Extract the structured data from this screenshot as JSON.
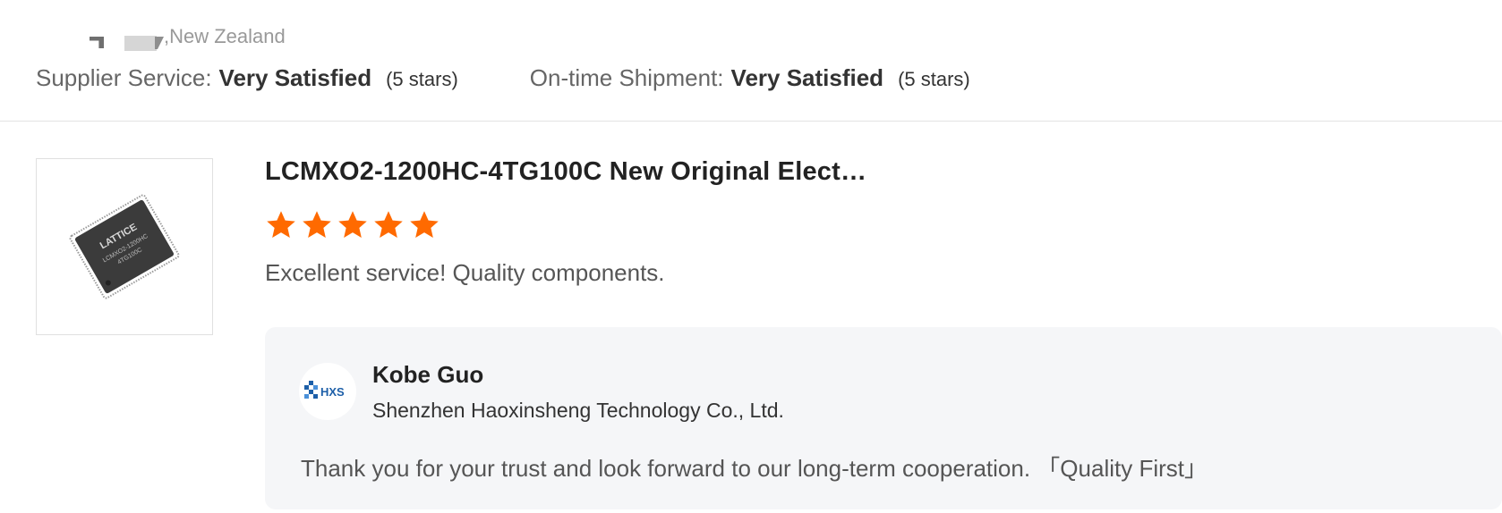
{
  "reviewer": {
    "location": ",New Zealand"
  },
  "ratings": {
    "supplier_service_label": "Supplier Service:",
    "supplier_service_value": "Very Satisfied",
    "supplier_service_stars": "(5 stars)",
    "shipment_label": "On-time Shipment:",
    "shipment_value": "Very Satisfied",
    "shipment_stars": "(5 stars)"
  },
  "product": {
    "title": "LCMXO2-1200HC-4TG100C New Original Elect…",
    "rating": 5,
    "rating_max": 5,
    "chip_text": [
      "LATTICE",
      "LCMXO2-1200HC",
      "4TG100C"
    ]
  },
  "review": {
    "text": "Excellent service! Quality components."
  },
  "reply": {
    "logo_text": "HXS",
    "name": "Kobe Guo",
    "company": "Shenzhen Haoxinsheng Technology Co., Ltd.",
    "text": "Thank you for your trust and look forward to our long-term cooperation. 「Quality First」"
  },
  "colors": {
    "star": "#ff6a00",
    "logo_blue": "#1d5fa8"
  }
}
